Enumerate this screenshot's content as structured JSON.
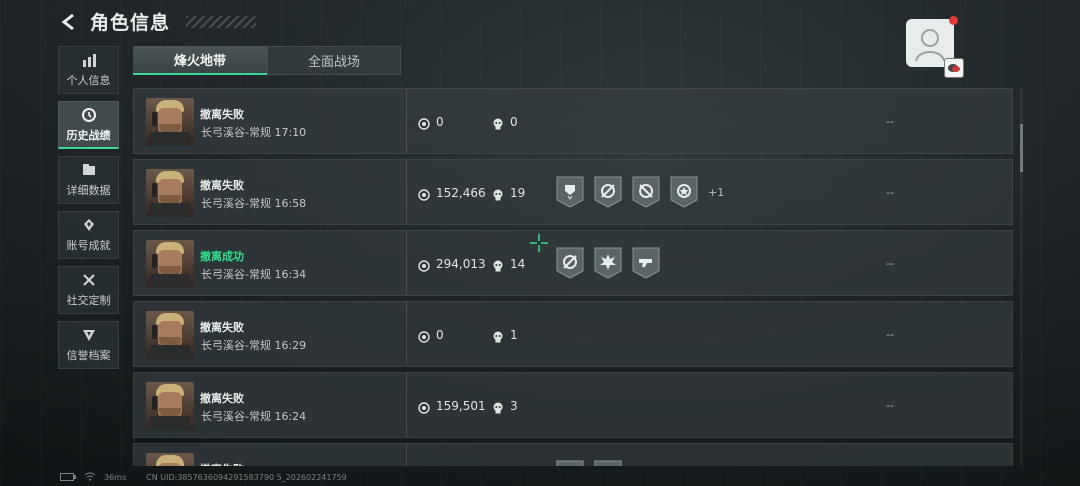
{
  "header": {
    "title": "角色信息"
  },
  "sidebar": {
    "items": [
      {
        "label": "个人信息",
        "icon": "bar-chart-icon",
        "active": false
      },
      {
        "label": "历史战绩",
        "icon": "clock-icon",
        "active": true
      },
      {
        "label": "详细数据",
        "icon": "folder-icon",
        "active": false
      },
      {
        "label": "账号成就",
        "icon": "achievement-icon",
        "active": false
      },
      {
        "label": "社交定制",
        "icon": "tools-icon",
        "active": false
      },
      {
        "label": "信誉档案",
        "icon": "shield-icon",
        "active": false
      }
    ]
  },
  "tabs": [
    {
      "label": "烽火地带",
      "active": true
    },
    {
      "label": "全面战场",
      "active": false
    }
  ],
  "records": [
    {
      "result": "撤离失败",
      "success": false,
      "map_time": "长弓溪谷-常规 17:10",
      "coins": "0",
      "kills": "0",
      "badges": [],
      "more": "",
      "extra": "--"
    },
    {
      "result": "撤离失败",
      "success": false,
      "map_time": "长弓溪谷-常规 16:58",
      "coins": "152,466",
      "kills": "19",
      "badges": [
        "medal-icon",
        "target-icon",
        "no-target-icon",
        "star-badge-icon"
      ],
      "more": "+1",
      "extra": "--"
    },
    {
      "result": "撤离成功",
      "success": true,
      "map_time": "长弓溪谷-常规 16:34",
      "coins": "294,013",
      "kills": "14",
      "badges": [
        "target-icon",
        "explosion-icon",
        "gun-icon"
      ],
      "more": "",
      "extra": "--"
    },
    {
      "result": "撤离失败",
      "success": false,
      "map_time": "长弓溪谷-常规 16:29",
      "coins": "0",
      "kills": "1",
      "badges": [],
      "more": "",
      "extra": "--"
    },
    {
      "result": "撤离失败",
      "success": false,
      "map_time": "长弓溪谷-常规 16:24",
      "coins": "159,501",
      "kills": "3",
      "badges": [],
      "more": "",
      "extra": "--"
    },
    {
      "result": "撤离失败",
      "success": false,
      "map_time": "",
      "coins": "",
      "kills": "",
      "badges": [
        "medal-icon",
        "medal-icon"
      ],
      "more": "",
      "extra": ""
    }
  ],
  "footer": {
    "ping": "36ms",
    "uid": "CN UID:3857636094291583790 5_202602241759"
  },
  "colors": {
    "accent": "#3fd69a",
    "success": "#2fe08f",
    "notify": "#e23a3a"
  }
}
